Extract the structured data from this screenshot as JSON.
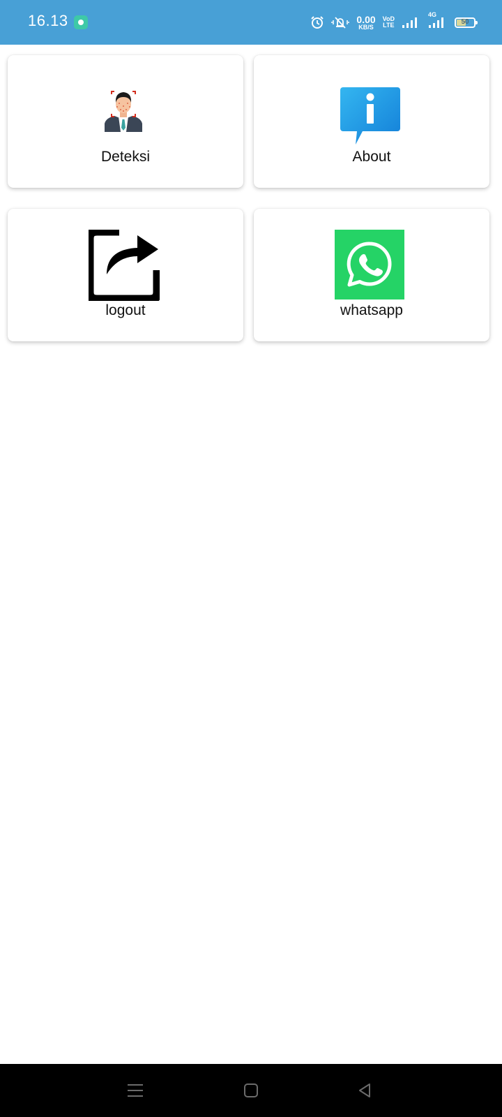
{
  "status_bar": {
    "time": "16.13",
    "net_speed_value": "0.00",
    "net_speed_unit": "KB/S",
    "volte_top": "VoD",
    "volte_bottom": "LTE",
    "network_type": "4G",
    "battery_level": "50",
    "background_color": "#48a0d6",
    "icons": [
      "app-notification-icon",
      "alarm-icon",
      "vibrate-mute-icon",
      "signal-icon",
      "signal-4g-icon",
      "battery-icon"
    ]
  },
  "menu": {
    "items": [
      {
        "label": "Deteksi",
        "icon": "face-detection-icon"
      },
      {
        "label": "About",
        "icon": "info-icon"
      },
      {
        "label": "logout",
        "icon": "logout-share-icon"
      },
      {
        "label": "whatsapp",
        "icon": "whatsapp-icon"
      }
    ]
  },
  "nav_bar": {
    "buttons": [
      "menu-icon",
      "home-icon",
      "back-icon"
    ]
  },
  "colors": {
    "info_blue": "#1f97e6",
    "whatsapp_green": "#25d366"
  }
}
